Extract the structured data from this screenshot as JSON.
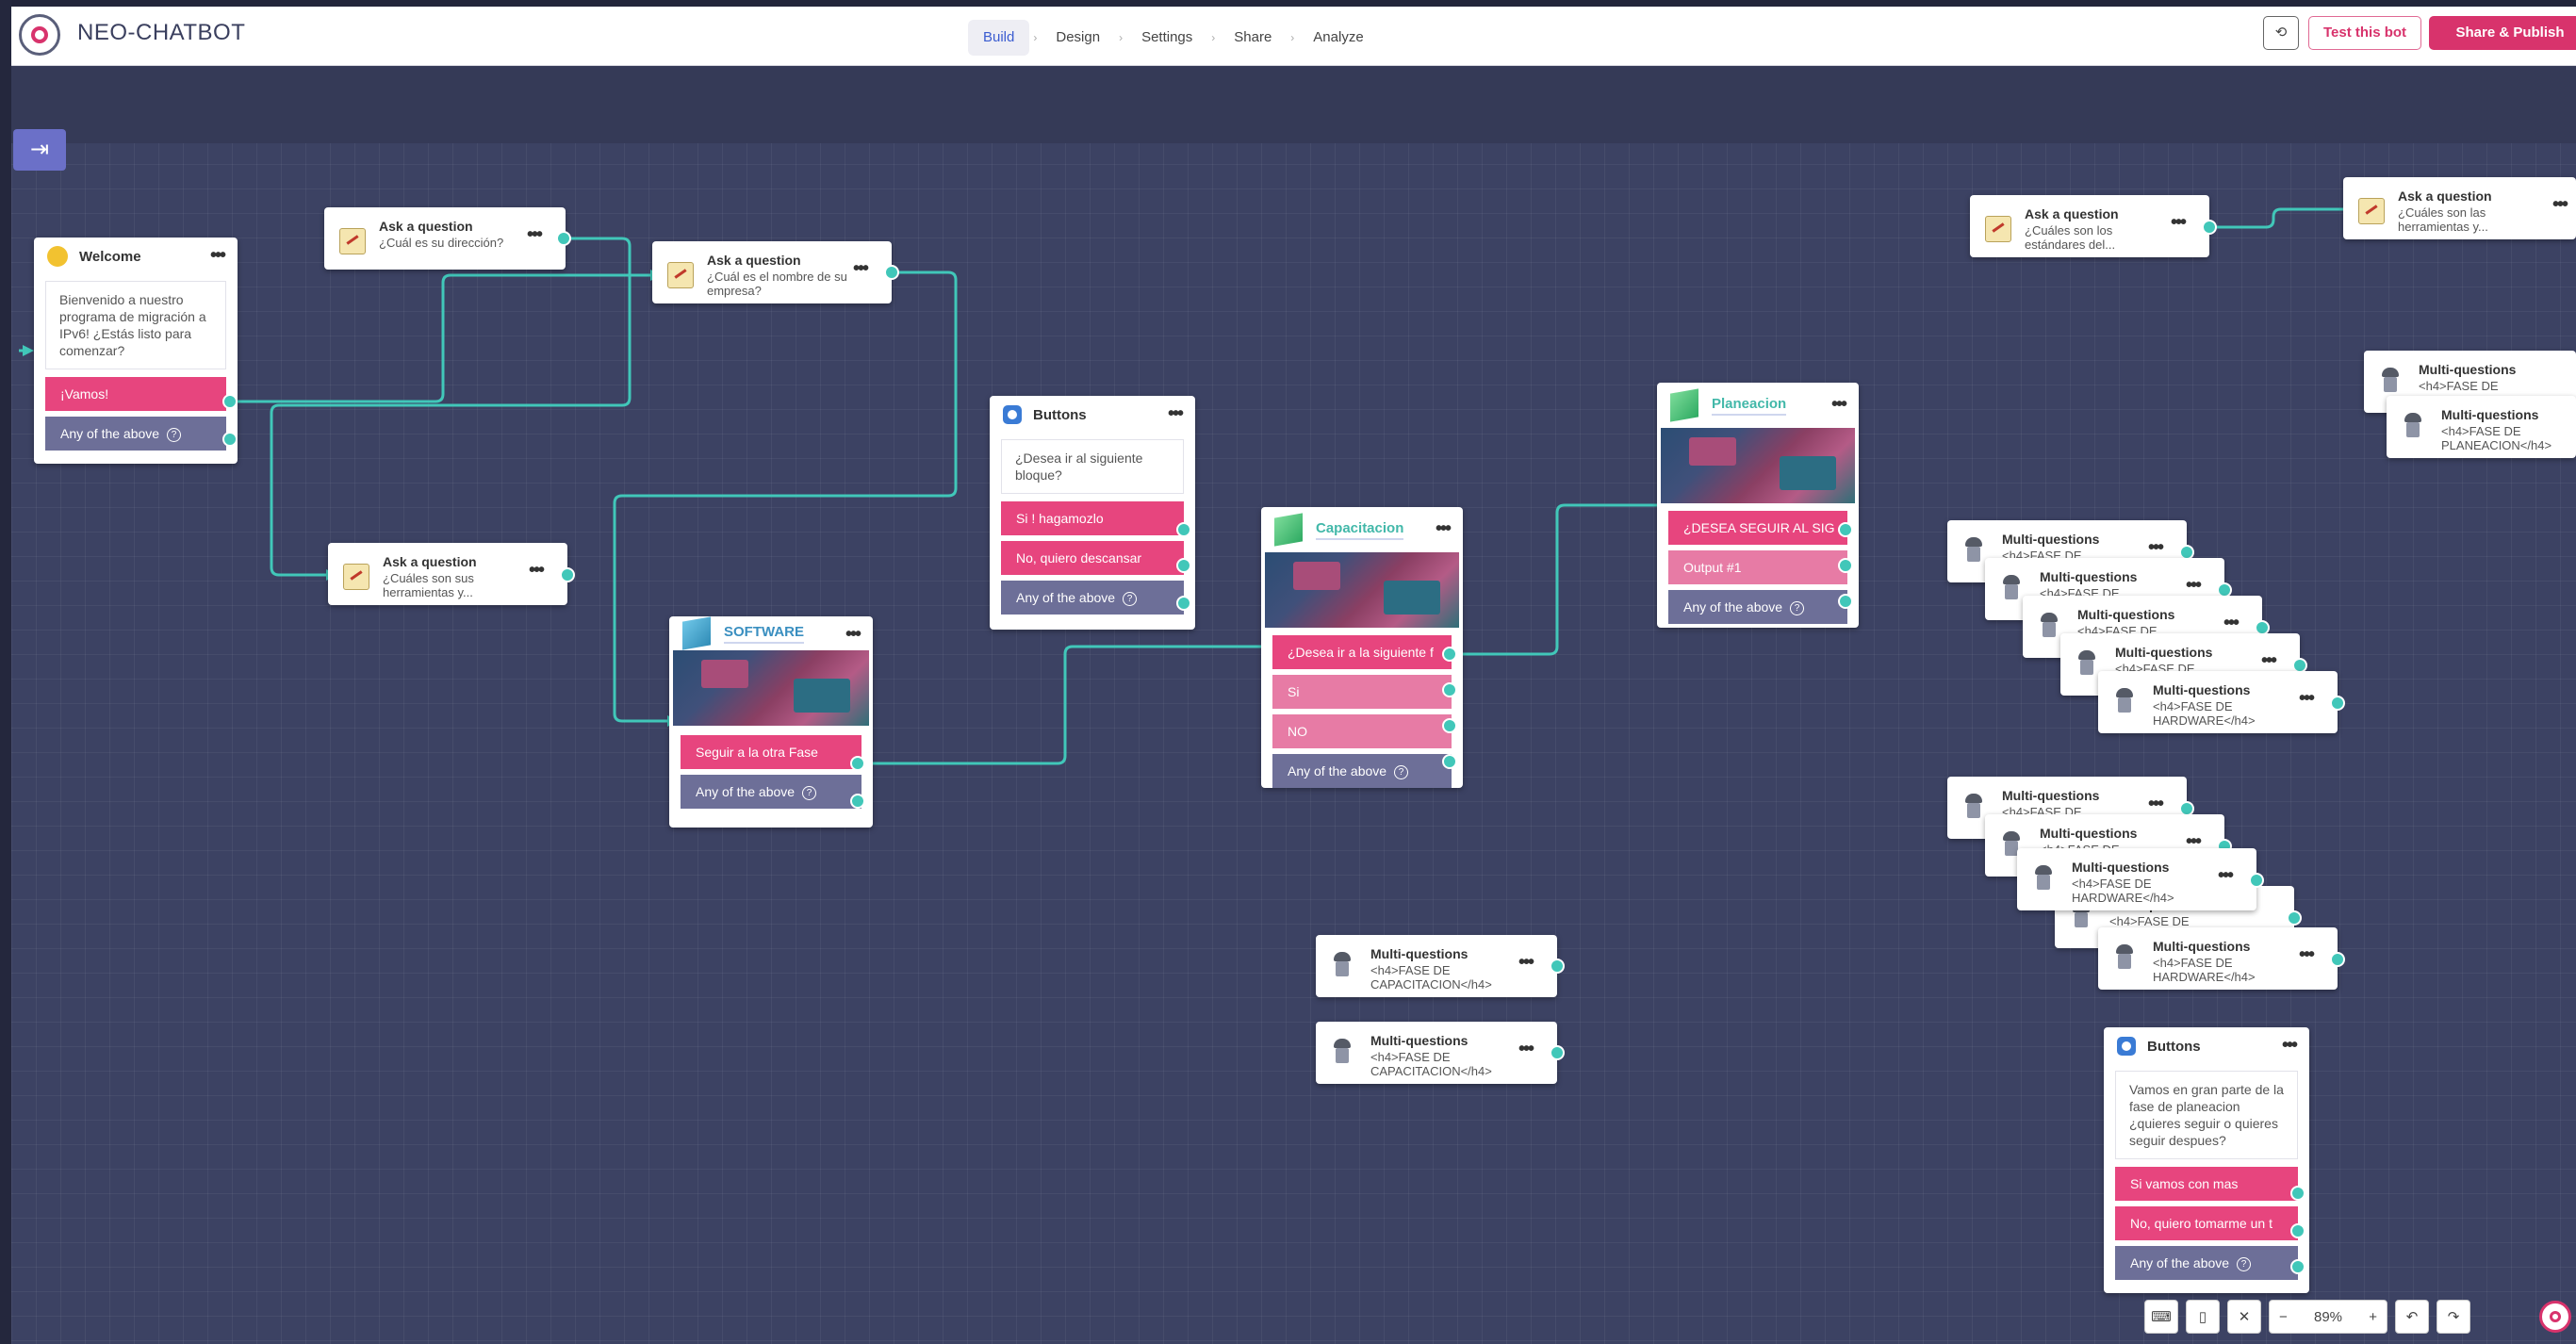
{
  "app": {
    "brand": "NEO-CHATBOT",
    "nav": [
      "Build",
      "Design",
      "Settings",
      "Share",
      "Analyze"
    ],
    "test_label": "Test this bot",
    "publish_label": "Share & Publish",
    "history_icon": "history-icon",
    "zoom": "89%",
    "help_glyph": "?",
    "add_glyph": "+",
    "minus_glyph": "−"
  },
  "colors": {
    "accent": "#d8336c",
    "wire": "#41c7b9",
    "canvas": "#3c4263",
    "option_pink": "#e7457e",
    "option_grey": "#6d6f98"
  },
  "nodes": {
    "welcome": {
      "title": "Welcome",
      "message": "Bienvenido a nuestro programa de migración a IPv6! ¿Estás listo para comenzar?",
      "options": [
        "¡Vamos!",
        "Any of the above"
      ]
    },
    "ask1": {
      "title": "Ask a question",
      "sub": "¿Cuál es su dirección?"
    },
    "ask2": {
      "title": "Ask a question",
      "sub": "¿Cuál es el nombre de su empresa?"
    },
    "ask3": {
      "title": "Ask a question",
      "sub": "¿Cuáles son sus herramientas y..."
    },
    "ask4": {
      "title": "Ask a question",
      "sub": "¿Cuáles son los estándares del..."
    },
    "ask5": {
      "title": "Ask a question",
      "sub": "¿Cuáles son las herramientas y..."
    },
    "software": {
      "title": "SOFTWARE",
      "options": [
        "Seguir a la otra Fase",
        "Any of the above"
      ]
    },
    "buttons1": {
      "title": "Buttons",
      "message": "¿Desea ir al siguiente bloque?",
      "options": [
        "Si ! hagamozlo",
        "No, quiero descansar",
        "Any of the above"
      ]
    },
    "capacitacion": {
      "title": "Capacitacion",
      "options": [
        "¿Desea ir a la siguiente f",
        "Si",
        "NO",
        "Any of the above"
      ]
    },
    "planeacion": {
      "title": "Planeacion",
      "options": [
        "¿DESEA SEGUIR AL SIG",
        "Output #1",
        "Any of the above"
      ]
    },
    "buttons2": {
      "title": "Buttons",
      "message": "Vamos en gran parte de la fase de planeacion ¿quieres seguir o quieres seguir despues?",
      "options": [
        "Si vamos con mas",
        "No, quiero tomarme un t",
        "Any of the above"
      ]
    },
    "multi": {
      "title": "Multi-questions",
      "cap": "<h4>FASE DE CAPACITACION</h4>",
      "hw": "<h4>FASE DE HARDWARE</h4>",
      "plan": "<h4>FASE DE PLANEACION</h4>",
      "short": "<h4>FASE DE"
    }
  }
}
